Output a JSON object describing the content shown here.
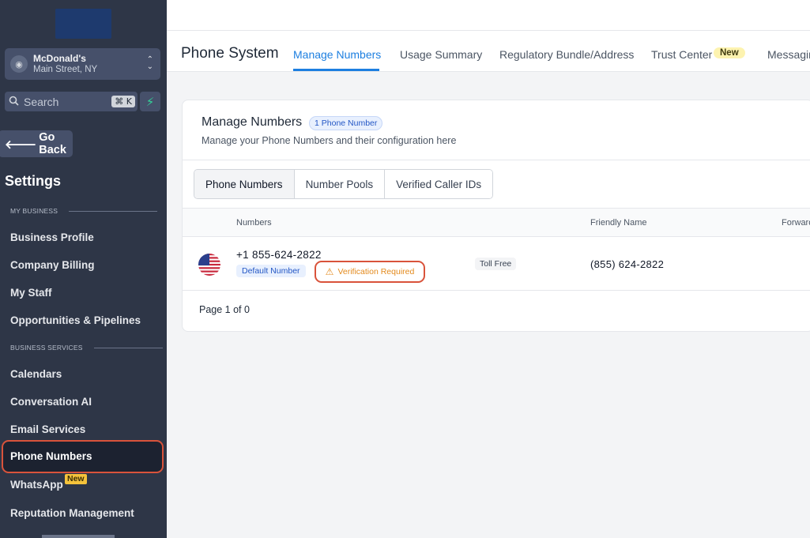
{
  "sidebar": {
    "location": {
      "name": "McDonald's",
      "address": "Main Street, NY"
    },
    "search": {
      "placeholder": "Search",
      "shortcut": "⌘ K"
    },
    "go_back": "Go Back",
    "settings_title": "Settings",
    "sections": [
      {
        "label": "MY BUSINESS",
        "items": [
          "Business Profile",
          "Company Billing",
          "My Staff",
          "Opportunities & Pipelines"
        ]
      },
      {
        "label": "BUSINESS SERVICES",
        "items": [
          "Calendars",
          "Conversation AI",
          "Email Services",
          "Phone Numbers",
          "WhatsApp",
          "Reputation Management"
        ]
      }
    ],
    "active_item": "Phone Numbers",
    "whatsapp_badge": "New"
  },
  "header": {
    "title": "Phone System",
    "tabs": [
      {
        "label": "Manage Numbers",
        "active": true
      },
      {
        "label": "Usage Summary"
      },
      {
        "label": "Regulatory Bundle/Address"
      },
      {
        "label": "Trust Center",
        "badge": "New"
      },
      {
        "label": "Messaging"
      }
    ]
  },
  "card": {
    "title": "Manage Numbers",
    "count_badge": "1 Phone Number",
    "subtitle": "Manage your Phone Numbers and their configuration here",
    "segment_tabs": [
      "Phone Numbers",
      "Number Pools",
      "Verified Caller IDs"
    ],
    "columns": {
      "numbers": "Numbers",
      "friendly_name": "Friendly Name",
      "forward": "Forwarding"
    },
    "rows": [
      {
        "country_flag": "us-flag-icon",
        "number": "+1 855-624-2822",
        "default_badge": "Default Number",
        "verification_badge": "Verification Required",
        "type": "Toll Free",
        "friendly_name": "(855) 624-2822"
      }
    ],
    "pagination": "Page 1 of 0"
  },
  "colors": {
    "sidebar_bg": "#2e3647",
    "accent_blue": "#1d7fe0",
    "highlight_red": "#d9533b",
    "warning_orange": "#e38a1d"
  }
}
